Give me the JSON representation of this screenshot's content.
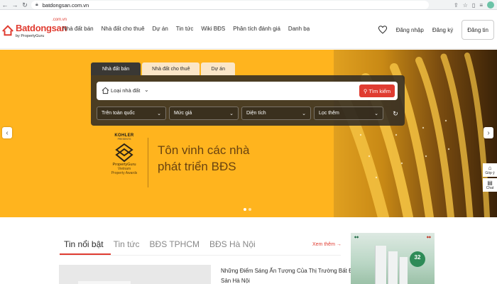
{
  "browser": {
    "url": "batdongsan.com.vn"
  },
  "logo": {
    "name": "Batdongsan",
    "domain": ".com.vn",
    "tagline": "by PropertyGuru"
  },
  "nav": [
    {
      "label": "Nhà đất bán"
    },
    {
      "label": "Nhà đất cho thuê"
    },
    {
      "label": "Dự án"
    },
    {
      "label": "Tin tức"
    },
    {
      "label": "Wiki BĐS"
    },
    {
      "label": "Phân tích đánh giá"
    },
    {
      "label": "Danh bạ"
    }
  ],
  "header_actions": {
    "login": "Đăng nhập",
    "register": "Đăng ký",
    "post": "Đăng tin"
  },
  "search": {
    "tabs": [
      {
        "label": "Nhà đất bán",
        "active": true
      },
      {
        "label": "Nhà đất cho thuê",
        "active": false
      },
      {
        "label": "Dự án",
        "active": false
      }
    ],
    "property_type": "Loại nhà đất",
    "submit": "Tìm kiếm",
    "filters": [
      {
        "label": "Trên toàn quốc"
      },
      {
        "label": "Mức giá"
      },
      {
        "label": "Diện tích"
      },
      {
        "label": "Lọc thêm"
      }
    ]
  },
  "banner": {
    "sponsor": "KOHLER",
    "presents": "PRESENTS",
    "award_brand": "PropertyGuru",
    "award_sub": [
      "Vietnam",
      "Property Awards"
    ],
    "headline": [
      "Tôn vinh các nhà",
      "phát triển BĐS"
    ],
    "slide_count": 2,
    "active_slide": 0
  },
  "side_tools": [
    {
      "label": "Góp ý",
      "icon": "feedback-icon"
    },
    {
      "label": "Chat",
      "icon": "chat-icon"
    }
  ],
  "news": {
    "tabs": [
      {
        "label": "Tin nổi bật",
        "active": true
      },
      {
        "label": "Tin tức",
        "active": false
      },
      {
        "label": "BĐS TPHCM",
        "active": false
      },
      {
        "label": "BĐS Hà Nội",
        "active": false
      }
    ],
    "see_more": "Xem thêm",
    "headline": "Những Điểm Sáng Ấn Tượng Của Thị Trường Bất Động Sản Hà Nội"
  },
  "ad": {
    "badge_number": "32",
    "colors": {
      "accent": "#e03c31",
      "hero_bg": "#ffb41e"
    }
  }
}
